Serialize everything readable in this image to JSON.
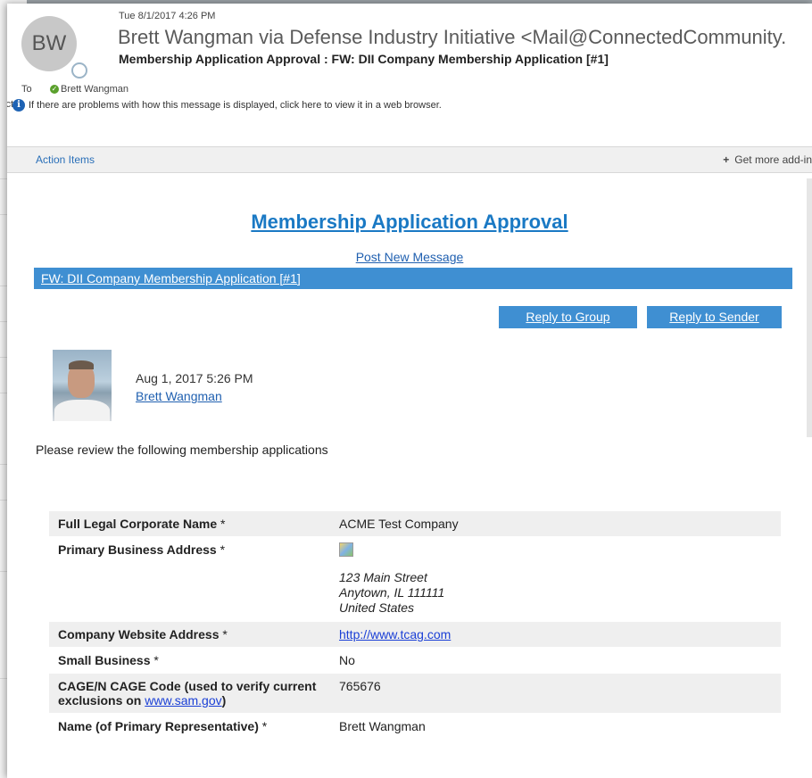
{
  "header": {
    "avatar_initials": "BW",
    "date": "Tue 8/1/2017 4:26 PM",
    "from": "Brett Wangman via Defense Industry Initiative <Mail@ConnectedCommunity.",
    "subject": "Membership Application Approval : FW: DII Company Membership Application [#1]",
    "to_label": "To",
    "to_name": "Brett Wangman",
    "info_prefix": "pictu",
    "info_text": "If there are problems with how this message is displayed, click here to view it in a web browser.",
    "action_items": "Action Items",
    "get_addins": "Get more add-in"
  },
  "message": {
    "title": "Membership Application Approval",
    "post_new": "Post New Message",
    "thread_title": "FW: DII Company Membership Application [#1]",
    "reply_group": "Reply to Group",
    "reply_sender": "Reply to Sender",
    "post_date": "Aug 1, 2017 5:26 PM",
    "author": "Brett Wangman",
    "intro": "Please review the following membership applications"
  },
  "application": {
    "legal_name_label": "Full Legal Corporate Name",
    "legal_name_value": "ACME Test Company",
    "address_label": "Primary Business Address",
    "address_line1": "123 Main Street",
    "address_line2": "Anytown, IL 111111",
    "address_line3": "United States",
    "website_label": "Company Website Address",
    "website_value": "http://www.tcag.com",
    "small_business_label": "Small Business",
    "small_business_value": "No",
    "cage_label": "CAGE/N CAGE Code (used to verify current exclusions on",
    "cage_link": "www.sam.gov",
    "cage_label_end": ")",
    "cage_value": "765676",
    "rep_name_label": "Name (of Primary Representative)",
    "rep_name_value": "Brett Wangman",
    "required_mark": "*"
  },
  "colors": {
    "accent_blue": "#3f8fd2",
    "link_blue": "#1a79c4",
    "presence_green": "#5aa02c"
  }
}
